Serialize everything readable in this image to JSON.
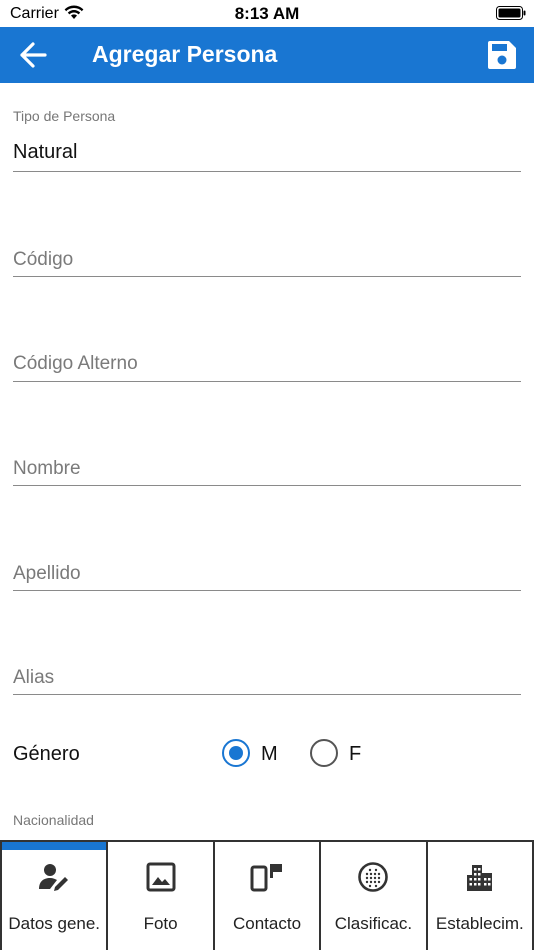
{
  "status_bar": {
    "carrier": "Carrier",
    "time": "8:13 AM"
  },
  "app_bar": {
    "title": "Agregar Persona",
    "background": "#1976d2",
    "back_icon": "arrow-left-icon",
    "save_icon": "floppy-disk-icon"
  },
  "form": {
    "tipo_persona": {
      "label": "Tipo de Persona",
      "value": "Natural"
    },
    "codigo": {
      "placeholder": "Código"
    },
    "codigo_alterno": {
      "placeholder": "Código Alterno"
    },
    "nombre": {
      "placeholder": "Nombre"
    },
    "apellido": {
      "placeholder": "Apellido"
    },
    "alias": {
      "placeholder": "Alias"
    },
    "genero": {
      "label": "Género",
      "options": [
        {
          "label": "M",
          "selected": true
        },
        {
          "label": "F",
          "selected": false
        }
      ]
    },
    "nacionalidad": {
      "label": "Nacionalidad"
    }
  },
  "tabs": [
    {
      "label": "Datos gene.",
      "icon": "person-edit-icon",
      "active": true
    },
    {
      "label": "Foto",
      "icon": "image-icon",
      "active": false
    },
    {
      "label": "Contacto",
      "icon": "devices-icon",
      "active": false
    },
    {
      "label": "Clasificac.",
      "icon": "dots-grid-icon",
      "active": false
    },
    {
      "label": "Establecim.",
      "icon": "buildings-icon",
      "active": false
    }
  ]
}
